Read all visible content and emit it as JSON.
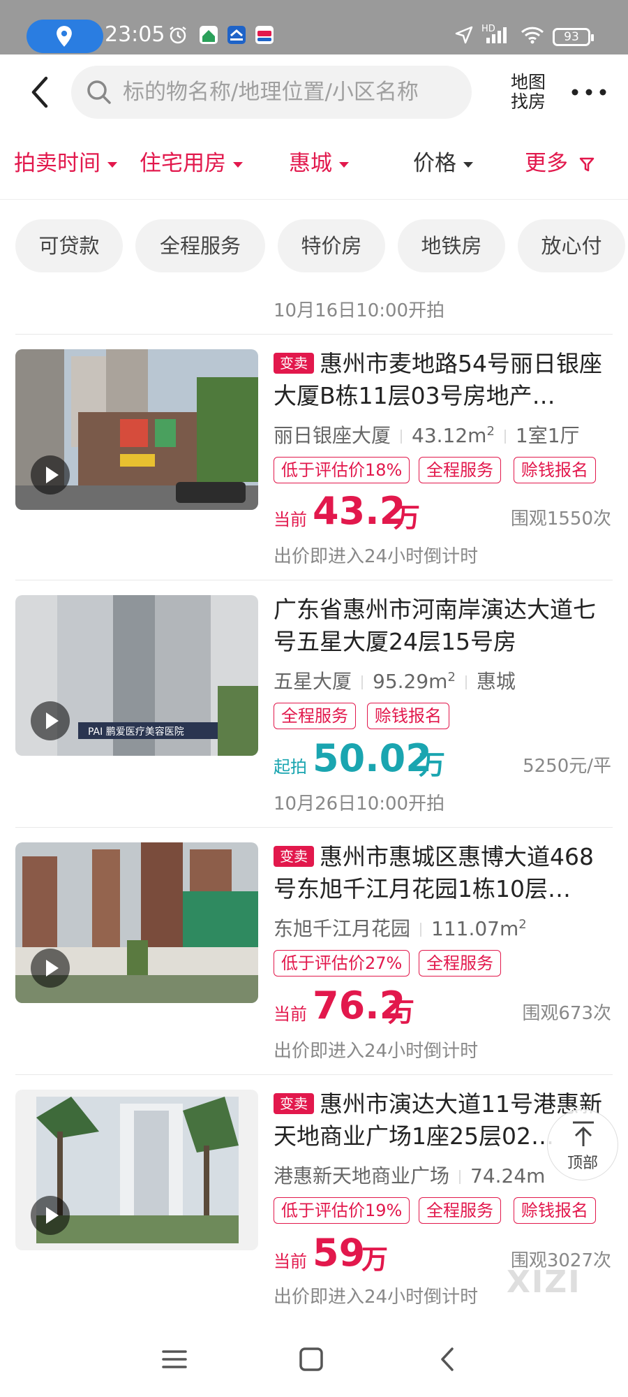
{
  "status_bar": {
    "time": "23:05",
    "battery": "93",
    "icons": [
      "location-pin-icon",
      "alarm-icon",
      "app-icon-1",
      "app-icon-2",
      "app-icon-3",
      "navigation-icon",
      "signal-icon",
      "wifi-icon",
      "battery-icon"
    ],
    "hd_label": "HD",
    "accent": "#2a7de1"
  },
  "header": {
    "search_placeholder": "标的物名称/地理位置/小区名称",
    "map_line1": "地图",
    "map_line2": "找房"
  },
  "filters": [
    {
      "label": "拍卖时间",
      "active": true
    },
    {
      "label": "住宅用房",
      "active": true
    },
    {
      "label": "惠城",
      "active": true
    },
    {
      "label": "价格",
      "active": false
    },
    {
      "label": "更多",
      "active": true
    }
  ],
  "chips": [
    "可贷款",
    "全程服务",
    "特价房",
    "地铁房",
    "放心付"
  ],
  "prev_time": "10月16日10:00开拍",
  "listings": [
    {
      "tag": "变卖",
      "title": "惠州市麦地路54号丽日银座大厦B栋11层03号房地产…",
      "community": "丽日银座大厦",
      "area": "43.12m",
      "area_sup": "2",
      "extra": "1室1厅",
      "badges": [
        "低于评估价18%",
        "全程服务",
        "赊钱报名"
      ],
      "price_label": "当前",
      "price": "43.2",
      "price_unit": "万",
      "right_info": "围观1550次",
      "footer": "出价即进入24小时倒计时"
    },
    {
      "tag": "",
      "title": "广东省惠州市河南岸演达大道七号五星大厦24层15号房",
      "community": "五星大厦",
      "area": "95.29m",
      "area_sup": "2",
      "extra": "惠城",
      "badges": [
        "全程服务",
        "赊钱报名"
      ],
      "price_label": "起拍",
      "price": "50.02",
      "price_unit": "万",
      "right_info": "5250元/平",
      "footer": "10月26日10:00开拍",
      "sign_text": "PAI 鹏爱医疗美容医院"
    },
    {
      "tag": "变卖",
      "title": "惠州市惠城区惠博大道468号东旭千江月花园1栋10层…",
      "community": "东旭千江月花园",
      "area": "111.07m",
      "area_sup": "2",
      "extra": "",
      "badges": [
        "低于评估价27%",
        "全程服务"
      ],
      "price_label": "当前",
      "price": "76.2",
      "price_unit": "万",
      "right_info": "围观673次",
      "footer": "出价即进入24小时倒计时"
    },
    {
      "tag": "变卖",
      "title": "惠州市演达大道11号港惠新天地商业广场1座25层02…",
      "community": "港惠新天地商业广场",
      "area": "74.24m",
      "area_sup": "",
      "extra": "",
      "badges": [
        "低于评估价19%",
        "全程服务",
        "赊钱报名"
      ],
      "price_label": "当前",
      "price": "59",
      "price_unit": "万",
      "right_info": "围观3027次",
      "footer": "出价即进入24小时倒计时"
    }
  ],
  "top_button": "顶部",
  "watermark": "XIZI",
  "colors": {
    "accent_red": "#e2184c",
    "teal": "#1aa5b0"
  }
}
